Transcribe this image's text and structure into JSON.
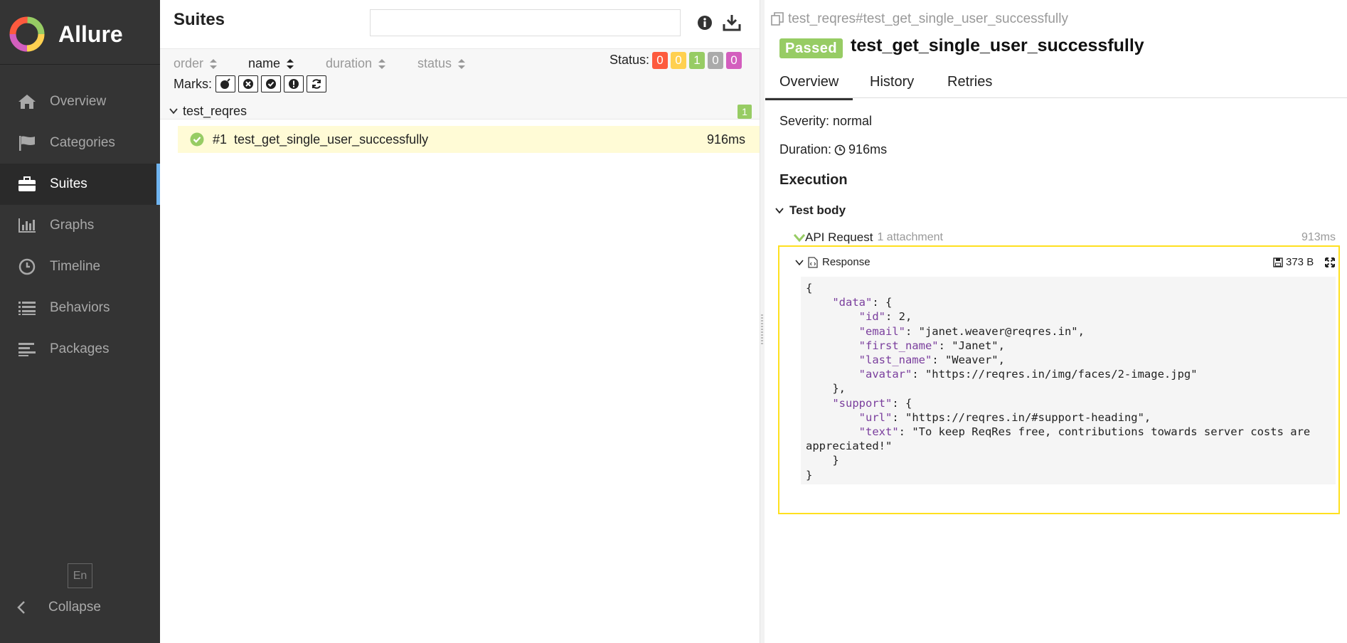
{
  "app": {
    "name": "Allure"
  },
  "sidebar": {
    "items": [
      {
        "label": "Overview",
        "icon": "home-icon"
      },
      {
        "label": "Categories",
        "icon": "flag-icon"
      },
      {
        "label": "Suites",
        "icon": "briefcase-icon",
        "active": true
      },
      {
        "label": "Graphs",
        "icon": "bar-chart-icon"
      },
      {
        "label": "Timeline",
        "icon": "clock-icon"
      },
      {
        "label": "Behaviors",
        "icon": "list-icon"
      },
      {
        "label": "Packages",
        "icon": "align-left-icon"
      }
    ],
    "language": "En",
    "collapse_label": "Collapse"
  },
  "suites": {
    "title": "Suites",
    "search_value": "",
    "sort": {
      "order": "order",
      "name": "name",
      "duration": "duration",
      "status": "status"
    },
    "status_label": "Status:",
    "status_counts": [
      {
        "value": "0",
        "color": "#fd5a3e"
      },
      {
        "value": "0",
        "color": "#ffd050"
      },
      {
        "value": "1",
        "color": "#97cc64"
      },
      {
        "value": "0",
        "color": "#aaaaaa"
      },
      {
        "value": "0",
        "color": "#d35ebe"
      }
    ],
    "marks_label": "Marks:",
    "group": {
      "name": "test_reqres",
      "count": "1"
    },
    "test": {
      "number": "#1",
      "name": "test_get_single_user_successfully",
      "duration": "916ms"
    }
  },
  "detail": {
    "breadcrumb": "test_reqres#test_get_single_user_successfully",
    "status": "Passed",
    "title": "test_get_single_user_successfully",
    "tabs": [
      "Overview",
      "History",
      "Retries"
    ],
    "severity": "Severity: normal",
    "duration_label": "Duration:",
    "duration_value": "916ms",
    "execution_title": "Execution",
    "test_body_label": "Test body",
    "step": {
      "name": "API Request",
      "attachments": "1 attachment",
      "duration": "913ms"
    },
    "attachment": {
      "name": "Response",
      "size": "373 B"
    },
    "response_body": "{\n    \"data\": {\n        \"id\": 2,\n        \"email\": \"janet.weaver@reqres.in\",\n        \"first_name\": \"Janet\",\n        \"last_name\": \"Weaver\",\n        \"avatar\": \"https://reqres.in/img/faces/2-image.jpg\"\n    },\n    \"support\": {\n        \"url\": \"https://reqres.in/#support-heading\",\n        \"text\": \"To keep ReqRes free, contributions towards server costs are appreciated!\"\n    }\n}"
  },
  "colors": {
    "sidebar_bg": "#343434",
    "accent": "#6fb4f0",
    "passed": "#97cc64",
    "highlight_row": "#fffbd6",
    "attachment_border": "#ffe01f"
  }
}
